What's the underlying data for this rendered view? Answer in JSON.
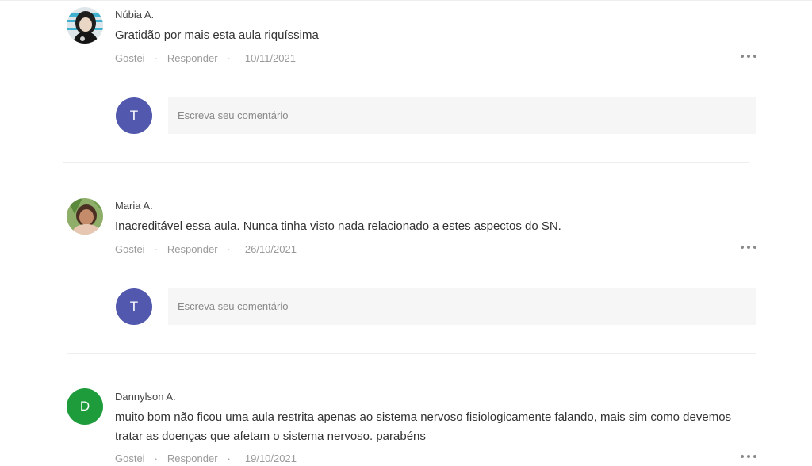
{
  "comments": [
    {
      "author": "Núbia A.",
      "text": "Gratidão por mais esta aula riquíssima",
      "like_label": "Gostei",
      "reply_label": "Responder",
      "separator": "·",
      "date": "10/11/2021",
      "reply_avatar_letter": "T",
      "reply_placeholder": "Escreva seu comentário"
    },
    {
      "author": "Maria A.",
      "text": "Inacreditável essa aula. Nunca tinha visto nada relacionado a estes aspectos do SN.",
      "like_label": "Gostei",
      "reply_label": "Responder",
      "separator": "·",
      "date": "26/10/2021",
      "reply_avatar_letter": "T",
      "reply_placeholder": "Escreva seu comentário"
    },
    {
      "author": "Dannylson A.",
      "avatar_letter": "D",
      "text": "muito bom não ficou uma aula restrita apenas ao sistema nervoso fisiologicamente falando, mais sim como devemos tratar as doenças que afetam o sistema nervoso. parabéns",
      "like_label": "Gostei",
      "reply_label": "Responder",
      "separator": "·",
      "date": "19/10/2021"
    }
  ],
  "colors": {
    "reply_avatar_bg": "#5158ad",
    "letter_avatar_bg": "#1e9c3c",
    "input_bg": "#f6f6f6",
    "meta_text": "#9a9a9a"
  },
  "icons": {
    "more": "more-options-icon",
    "user_photo": "user-photo-avatar"
  }
}
